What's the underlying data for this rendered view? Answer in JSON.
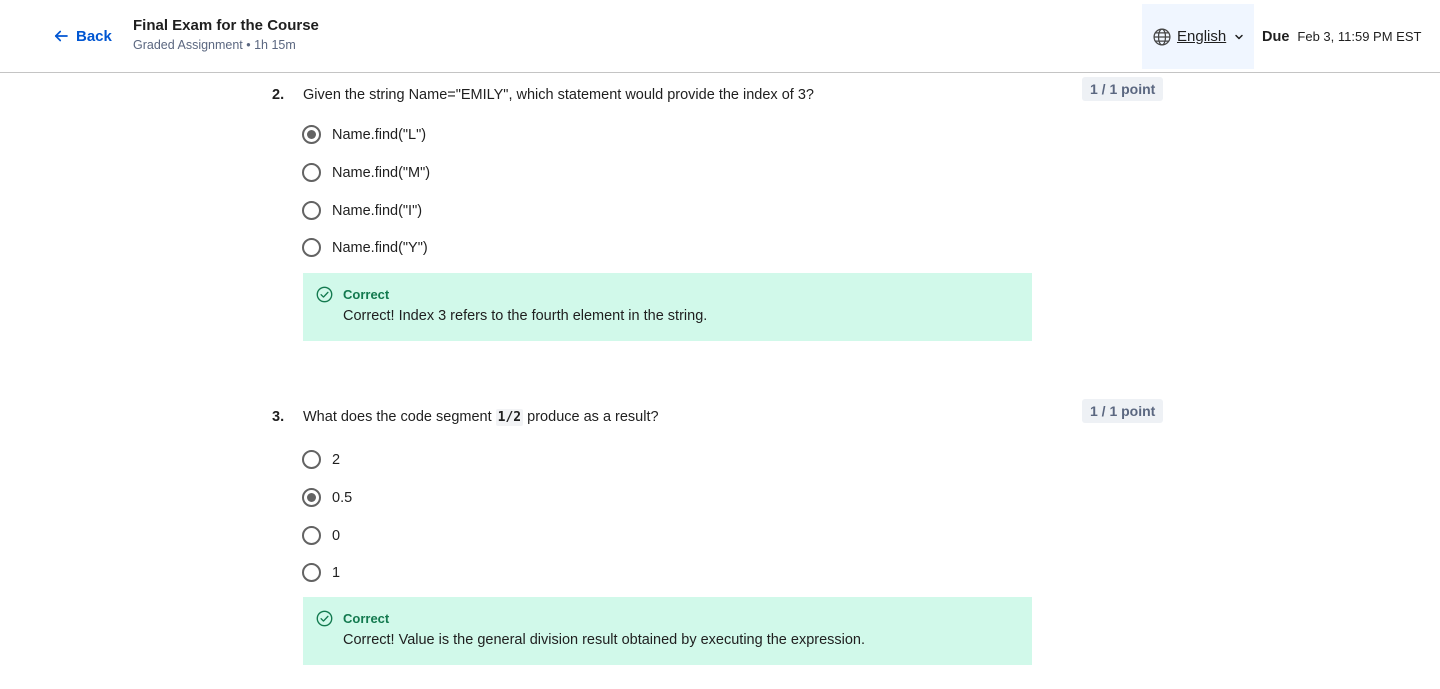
{
  "header": {
    "back_label": "Back",
    "title": "Final Exam for the Course",
    "subtitle": "Graded Assignment • 1h 15m",
    "language": "English",
    "due_label": "Due",
    "due_date": "Feb 3, 11:59 PM EST"
  },
  "questions": [
    {
      "number": "2.",
      "text": "Given the string Name=\"EMILY\", which statement would provide the index of 3?",
      "points": "1 / 1 point",
      "options": [
        {
          "label": "Name.find(\"L\")",
          "selected": true
        },
        {
          "label": "Name.find(\"M\")",
          "selected": false
        },
        {
          "label": "Name.find(\"I\")",
          "selected": false
        },
        {
          "label": "Name.find(\"Y\")",
          "selected": false
        }
      ],
      "feedback": {
        "status": "Correct",
        "text": "Correct! Index 3 refers to the fourth element in the string."
      }
    },
    {
      "number": "3.",
      "text_before": "What does the code segment ",
      "code": "1/2",
      "text_after": " produce as a result?",
      "points": "1 / 1 point",
      "options": [
        {
          "label": "2",
          "selected": false
        },
        {
          "label": "0.5",
          "selected": true
        },
        {
          "label": "0",
          "selected": false
        },
        {
          "label": "1",
          "selected": false
        }
      ],
      "feedback": {
        "status": "Correct",
        "text": "Correct! Value is the general division result obtained by executing the expression."
      }
    }
  ],
  "colors": {
    "accent": "#0056d2",
    "correct_bg": "#d1f9ea",
    "correct_text": "#137a4f",
    "language_bg": "#f0f6ff"
  },
  "icons": [
    "arrow-left-icon",
    "globe-icon",
    "chevron-down-icon",
    "check-circle-icon"
  ]
}
